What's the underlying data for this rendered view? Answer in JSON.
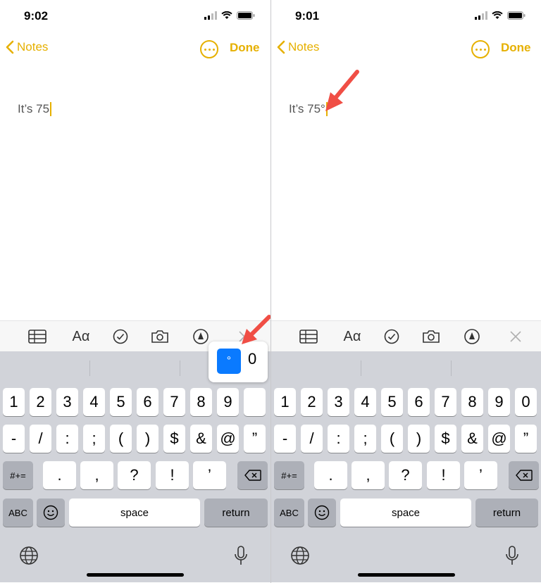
{
  "left": {
    "status": {
      "time": "9:02"
    },
    "nav": {
      "back_label": "Notes",
      "done_label": "Done"
    },
    "note": {
      "text": "It’s 75"
    },
    "popup": {
      "selected": "°",
      "alternate": "0"
    }
  },
  "right": {
    "status": {
      "time": "9:01"
    },
    "nav": {
      "back_label": "Notes",
      "done_label": "Done"
    },
    "note": {
      "text": "It’s 75°"
    }
  },
  "keyboard": {
    "row1": [
      "1",
      "2",
      "3",
      "4",
      "5",
      "6",
      "7",
      "8",
      "9",
      "0"
    ],
    "row2": [
      "-",
      "/",
      ":",
      ";",
      "(",
      ")",
      "$",
      "&",
      "@",
      "”"
    ],
    "row3": [
      ".",
      ",",
      "?",
      "!",
      "’"
    ],
    "symbols_key": "#+=",
    "abc_key": "ABC",
    "space_key": "space",
    "return_key": "return"
  },
  "icons": [
    "table-icon",
    "format-icon",
    "checklist-icon",
    "camera-icon",
    "markup-icon",
    "close-icon",
    "globe-icon",
    "microphone-icon",
    "emoji-icon",
    "backspace-icon",
    "signal-icon",
    "wifi-icon",
    "battery-icon",
    "more-icon",
    "chevron-left-icon"
  ],
  "colors": {
    "accent": "#e6b000",
    "popup_highlight": "#0a7aff",
    "arrow": "#f04e45",
    "keyboard_bg": "#d1d3d9"
  }
}
